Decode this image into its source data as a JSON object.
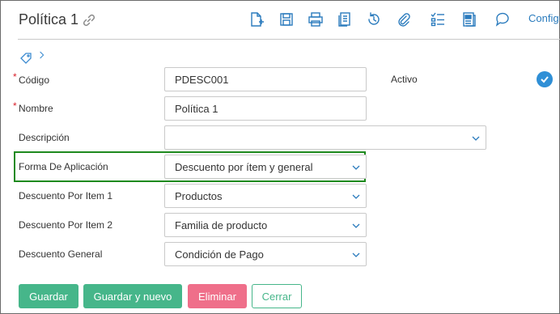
{
  "header": {
    "title": "Política 1",
    "config_label": "Configu"
  },
  "toolbar": {
    "icons": [
      "new-document-icon",
      "save-icon",
      "print-icon",
      "copy-icon",
      "history-icon",
      "attachment-icon",
      "checklist-icon",
      "report-icon",
      "comment-icon"
    ]
  },
  "form": {
    "codigo": {
      "label": "Código",
      "value": "PDESC001",
      "required": true
    },
    "nombre": {
      "label": "Nombre",
      "value": "Política 1",
      "required": true
    },
    "descripcion": {
      "label": "Descripción",
      "value": ""
    },
    "forma_aplicacion": {
      "label": "Forma De Aplicación",
      "value": "Descuento por ítem y general"
    },
    "descuento_item_1": {
      "label": "Descuento Por Item 1",
      "value": "Productos"
    },
    "descuento_item_2": {
      "label": "Descuento Por Item 2",
      "value": "Familia de producto"
    },
    "descuento_general": {
      "label": "Descuento General",
      "value": "Condición de Pago"
    },
    "activo": {
      "label": "Activo",
      "checked": true
    },
    "required_mark": "*"
  },
  "buttons": {
    "save": "Guardar",
    "save_new": "Guardar y nuevo",
    "delete": "Eliminar",
    "close": "Cerrar"
  },
  "colors": {
    "accent": "#2a7bbd",
    "success": "#46b68a",
    "danger": "#ef6f8a",
    "highlight": "#1e8a1e"
  }
}
